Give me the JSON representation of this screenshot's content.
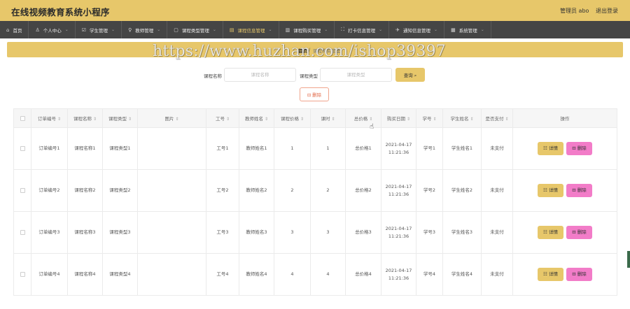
{
  "app": {
    "title": "在线视频教育系统小程序",
    "admin_label": "管理员 abo",
    "logout_label": "退出登录"
  },
  "nav": [
    {
      "label": "首页",
      "icon": "⌂"
    },
    {
      "label": "个人中心",
      "icon": "♙"
    },
    {
      "label": "学生管理",
      "icon": "☑"
    },
    {
      "label": "教师管理",
      "icon": "♀"
    },
    {
      "label": "课程类型管理",
      "icon": "▢"
    },
    {
      "label": "课程信息管理",
      "icon": "▤"
    },
    {
      "label": "课程购买管理",
      "icon": "▥"
    },
    {
      "label": "打卡信息管理",
      "icon": "⛶"
    },
    {
      "label": "通知信息管理",
      "icon": "✈"
    },
    {
      "label": "系统管理",
      "icon": "▦"
    }
  ],
  "breadcrumb": {
    "home": "首页",
    "separator": "/",
    "current": "课程购买管理"
  },
  "watermark": "https://www.huzhan.com/ishop39397",
  "search": {
    "course_name_label": "课程名称",
    "course_name_placeholder": "课程名称",
    "course_type_label": "课程类型",
    "course_type_placeholder": "课程类型",
    "query_label": "查询 ⌕",
    "delete_label": "⊟ 删除"
  },
  "table": {
    "headers": [
      "订单编号",
      "课程名称",
      "课程类型",
      "图片",
      "工号",
      "教师姓名",
      "课程价格",
      "课时",
      "总价格",
      "购买日期",
      "学号",
      "学生姓名",
      "是否支付",
      "操作"
    ],
    "rows": [
      {
        "order_no": "订单编号1",
        "course_name": "课程名称1",
        "course_type": "课程类型1",
        "image": "",
        "emp_no": "工号1",
        "teacher": "教师姓名1",
        "price": "1",
        "hours": "1",
        "total": "总价格1",
        "date": "2021-04-17",
        "time": "11:21:36",
        "student_no": "学号1",
        "student": "学生姓名1",
        "paid": "未支付"
      },
      {
        "order_no": "订单编号2",
        "course_name": "课程名称2",
        "course_type": "课程类型2",
        "image": "",
        "emp_no": "工号2",
        "teacher": "教师姓名2",
        "price": "2",
        "hours": "2",
        "total": "总价格2",
        "date": "2021-04-17",
        "time": "11:21:36",
        "student_no": "学号2",
        "student": "学生姓名2",
        "paid": "未支付"
      },
      {
        "order_no": "订单编号3",
        "course_name": "课程名称3",
        "course_type": "课程类型3",
        "image": "",
        "emp_no": "工号3",
        "teacher": "教师姓名3",
        "price": "3",
        "hours": "3",
        "total": "总价格3",
        "date": "2021-04-17",
        "time": "11:21:36",
        "student_no": "学号3",
        "student": "学生姓名3",
        "paid": "未支付"
      },
      {
        "order_no": "订单编号4",
        "course_name": "课程名称4",
        "course_type": "课程类型4",
        "image": "",
        "emp_no": "工号4",
        "teacher": "教师姓名4",
        "price": "4",
        "hours": "4",
        "total": "总价格4",
        "date": "2021-04-17",
        "time": "11:21:36",
        "student_no": "学号4",
        "student": "学生姓名4",
        "paid": "未支付"
      }
    ],
    "detail_label": "☷ 详情",
    "delete_label": "⊟ 删除"
  },
  "colors": {
    "accent": "#e7c76a",
    "nav_bg": "#454545",
    "delete_pink": "#f27cc8"
  }
}
